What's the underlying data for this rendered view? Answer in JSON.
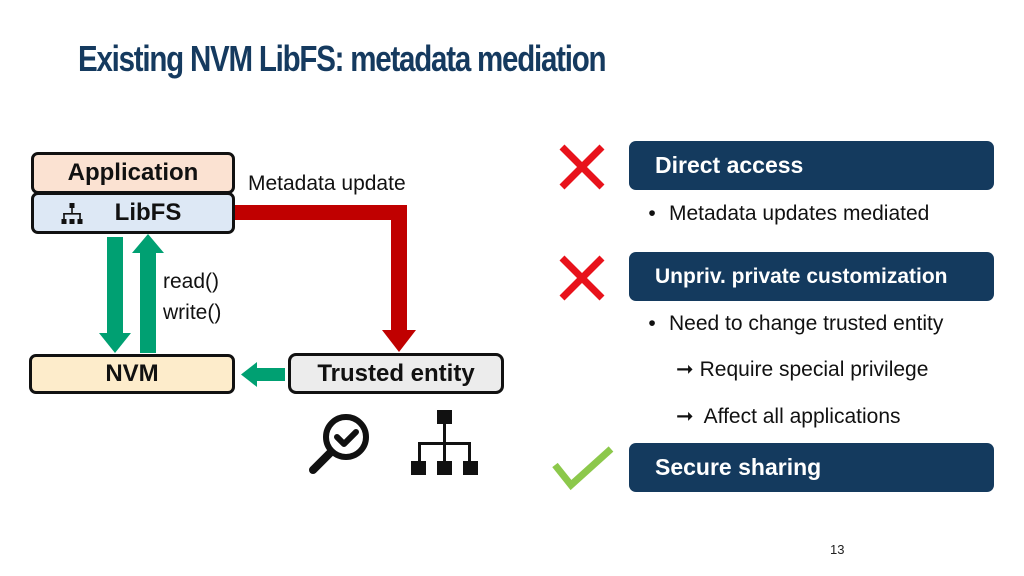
{
  "slide": {
    "title": "Existing NVM LibFS: metadata mediation",
    "page_number": "13"
  },
  "diagram": {
    "application_label": "Application",
    "libfs_label": "LibFS",
    "libfs_icon": "hierarchy-icon",
    "nvm_label": "NVM",
    "trusted_entity_label": "Trusted entity",
    "metadata_update_label": "Metadata update",
    "read_label": "read()",
    "write_label": "write()",
    "trusted_entity_icons": [
      "magnifier-check-icon",
      "hierarchy-icon"
    ],
    "colors": {
      "metadata_arrow": "#c00000",
      "data_arrow": "#00a072",
      "application_fill": "#fbe2d2",
      "libfs_fill": "#dde8f5",
      "nvm_fill": "#fdeccb",
      "trusted_fill": "#ececec"
    }
  },
  "properties": [
    {
      "status": "fail",
      "status_icon": "red-x-icon",
      "heading": "Direct access",
      "bullets": [
        "Metadata updates mediated"
      ],
      "sub_points": []
    },
    {
      "status": "fail",
      "status_icon": "red-x-icon",
      "heading": "Unpriv. private customization",
      "bullets": [
        "Need to change trusted entity"
      ],
      "sub_points": [
        "Require special privilege",
        "Affect all applications"
      ]
    },
    {
      "status": "pass",
      "status_icon": "green-check-icon",
      "heading": "Secure sharing",
      "bullets": [],
      "sub_points": []
    }
  ],
  "glyphs": {
    "bullet": "•",
    "arrow": "➞"
  },
  "colors": {
    "title": "#153a5f",
    "card_bg": "#143a5e",
    "fail": "#e8121b",
    "pass": "#8cc84b"
  }
}
